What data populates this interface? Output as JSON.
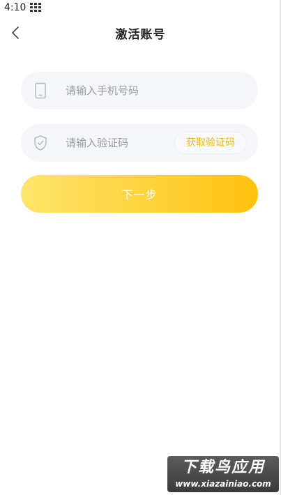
{
  "status_bar": {
    "time": "4:10",
    "icons": [
      "grid-icon"
    ]
  },
  "header": {
    "title": "激活账号",
    "back_icon": "chevron-left-icon"
  },
  "form": {
    "phone": {
      "icon": "phone-icon",
      "value": "",
      "placeholder": "请输入手机号码"
    },
    "code": {
      "icon": "shield-check-icon",
      "value": "",
      "placeholder": "请输入验证码",
      "get_code_label": "获取验证码"
    },
    "next_label": "下一步"
  },
  "colors": {
    "accent": "#ffc20e",
    "accent_light": "#fde56b",
    "link": "#f5b800",
    "field_bg": "#f5f6f9",
    "placeholder": "#9a9ca2"
  },
  "watermark": {
    "main": "下载鸟应用",
    "url": "www.xiazainiao.com"
  }
}
